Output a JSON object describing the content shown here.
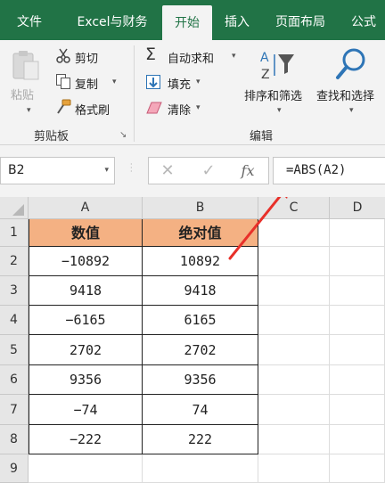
{
  "tabs": [
    {
      "label": "文件",
      "active": false
    },
    {
      "label": "Excel与财务",
      "active": false
    },
    {
      "label": "开始",
      "active": true
    },
    {
      "label": "插入",
      "active": false
    },
    {
      "label": "页面布局",
      "active": false
    },
    {
      "label": "公式",
      "active": false
    }
  ],
  "clipboard": {
    "paste": "粘贴",
    "cut": "剪切",
    "copy": "复制",
    "format_painter": "格式刷",
    "group_title": "剪贴板"
  },
  "editing": {
    "autosum": "自动求和",
    "fill": "填充",
    "clear": "清除",
    "sort_filter": "排序和筛选",
    "find_select": "查找和选择",
    "group_title": "编辑"
  },
  "formula_bar": {
    "name_box": "B2",
    "formula": "=ABS(A2)",
    "fx": "fx"
  },
  "columns": [
    "A",
    "B",
    "C",
    "D"
  ],
  "rows": [
    "1",
    "2",
    "3",
    "4",
    "5",
    "6",
    "7",
    "8",
    "9"
  ],
  "table": {
    "headers": [
      "数值",
      "绝对值"
    ],
    "rows": [
      [
        "−10892",
        "10892"
      ],
      [
        "9418",
        "9418"
      ],
      [
        "−6165",
        "6165"
      ],
      [
        "2702",
        "2702"
      ],
      [
        "9356",
        "9356"
      ],
      [
        "−74",
        "74"
      ],
      [
        "−222",
        "222"
      ]
    ]
  },
  "colors": {
    "ribbon_green": "#217346",
    "header_fill": "#f4b183",
    "arrow": "#e8302a"
  }
}
